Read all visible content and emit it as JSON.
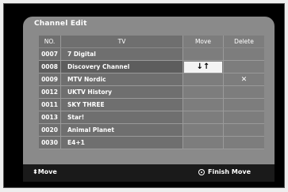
{
  "panel": {
    "title": "Channel Edit"
  },
  "table": {
    "headers": {
      "no": "NO.",
      "tv": "TV",
      "move": "Move",
      "delete": "Delete"
    },
    "rows": [
      {
        "no": "0007",
        "tv": "7 Digital",
        "move": "",
        "delete": ""
      },
      {
        "no": "0008",
        "tv": "Discovery Channel",
        "move": "↓↑",
        "delete": ""
      },
      {
        "no": "0009",
        "tv": "MTV Nordic",
        "move": "",
        "delete": "✕"
      },
      {
        "no": "0012",
        "tv": "UKTV History",
        "move": "",
        "delete": ""
      },
      {
        "no": "0011",
        "tv": "SKY THREE",
        "move": "",
        "delete": ""
      },
      {
        "no": "0013",
        "tv": "Star!",
        "move": "",
        "delete": ""
      },
      {
        "no": "0020",
        "tv": "Animal Planet",
        "move": "",
        "delete": ""
      },
      {
        "no": "0030",
        "tv": "E4+1",
        "move": "",
        "delete": ""
      }
    ]
  },
  "footer": {
    "move_icon": "⬍",
    "move_label": "Move",
    "finish_label": "Finish Move"
  }
}
